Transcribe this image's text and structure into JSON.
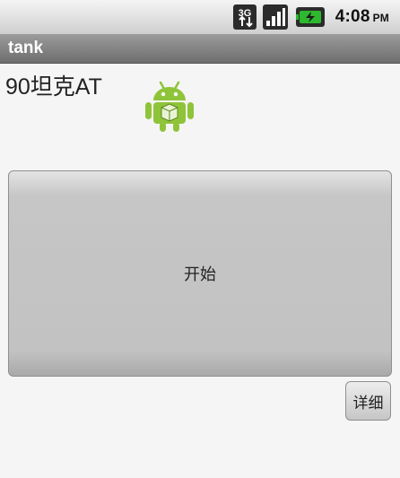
{
  "status_bar": {
    "network_label": "3G",
    "time": "4:08",
    "ampm": "PM",
    "icons": [
      "3g-data-icon",
      "signal-strength-icon",
      "battery-charging-icon"
    ],
    "battery_color": "#2eb82e"
  },
  "app_bar": {
    "title": "tank"
  },
  "main": {
    "level_label": "90坦克AT",
    "logo_icon": "android-robot-icon",
    "start_button_label": "开始",
    "detail_button_label": "详细"
  }
}
